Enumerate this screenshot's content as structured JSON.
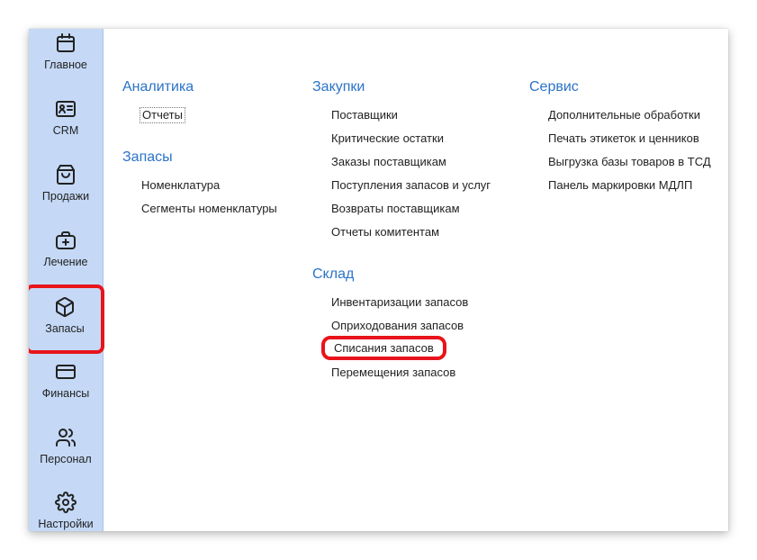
{
  "sidebar": {
    "items": [
      {
        "label": "Главное",
        "icon": "calendar-icon"
      },
      {
        "label": "CRM",
        "icon": "contact-card-icon"
      },
      {
        "label": "Продажи",
        "icon": "shopping-bag-icon"
      },
      {
        "label": "Лечение",
        "icon": "medical-bag-icon"
      },
      {
        "label": "Запасы",
        "icon": "box-icon"
      },
      {
        "label": "Финансы",
        "icon": "credit-card-icon"
      },
      {
        "label": "Персонал",
        "icon": "users-icon"
      },
      {
        "label": "Настройки",
        "icon": "gear-icon"
      }
    ]
  },
  "menu": {
    "analytics": {
      "title": "Аналитика",
      "items": [
        "Отчеты"
      ]
    },
    "stock": {
      "title": "Запасы",
      "items": [
        "Номенклатура",
        "Сегменты номенклатуры"
      ]
    },
    "purchases": {
      "title": "Закупки",
      "items": [
        "Поставщики",
        "Критические остатки",
        "Заказы поставщикам",
        "Поступления запасов и услуг",
        "Возвраты поставщикам",
        "Отчеты комитентам"
      ]
    },
    "warehouse": {
      "title": "Склад",
      "items": [
        "Инвентаризации запасов",
        "Оприходования запасов",
        "Списания запасов",
        "Перемещения запасов"
      ]
    },
    "service": {
      "title": "Сервис",
      "items": [
        "Дополнительные обработки",
        "Печать этикеток и ценников",
        "Выгрузка базы товаров в ТСД",
        "Панель маркировки МДЛП"
      ]
    }
  },
  "colors": {
    "accent": "#2b73c8",
    "sidebar": "#c5d9f6",
    "highlight": "#e8141b"
  }
}
